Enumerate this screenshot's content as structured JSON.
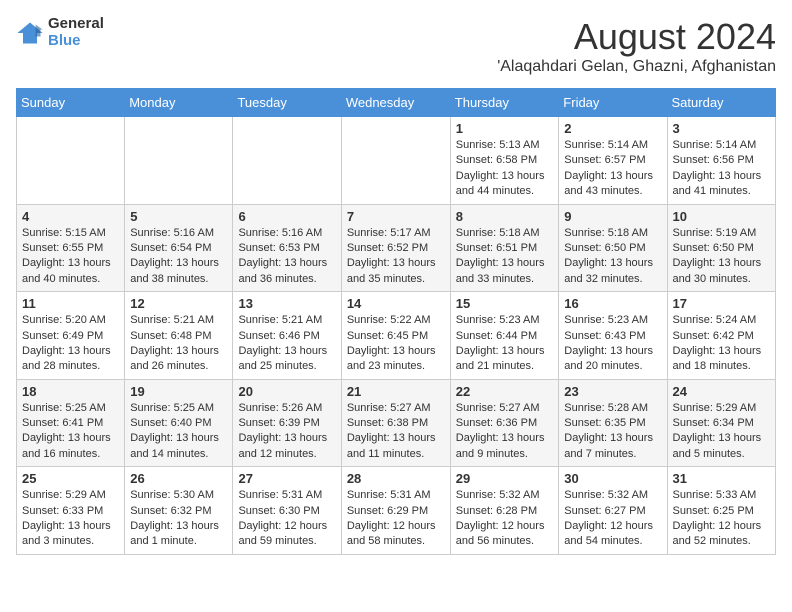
{
  "logo": {
    "general": "General",
    "blue": "Blue"
  },
  "title": {
    "month_year": "August 2024",
    "location": "'Alaqahdari Gelan, Ghazni, Afghanistan"
  },
  "weekdays": [
    "Sunday",
    "Monday",
    "Tuesday",
    "Wednesday",
    "Thursday",
    "Friday",
    "Saturday"
  ],
  "weeks": [
    [
      {
        "day": "",
        "info": ""
      },
      {
        "day": "",
        "info": ""
      },
      {
        "day": "",
        "info": ""
      },
      {
        "day": "",
        "info": ""
      },
      {
        "day": "1",
        "info": "Sunrise: 5:13 AM\nSunset: 6:58 PM\nDaylight: 13 hours\nand 44 minutes."
      },
      {
        "day": "2",
        "info": "Sunrise: 5:14 AM\nSunset: 6:57 PM\nDaylight: 13 hours\nand 43 minutes."
      },
      {
        "day": "3",
        "info": "Sunrise: 5:14 AM\nSunset: 6:56 PM\nDaylight: 13 hours\nand 41 minutes."
      }
    ],
    [
      {
        "day": "4",
        "info": "Sunrise: 5:15 AM\nSunset: 6:55 PM\nDaylight: 13 hours\nand 40 minutes."
      },
      {
        "day": "5",
        "info": "Sunrise: 5:16 AM\nSunset: 6:54 PM\nDaylight: 13 hours\nand 38 minutes."
      },
      {
        "day": "6",
        "info": "Sunrise: 5:16 AM\nSunset: 6:53 PM\nDaylight: 13 hours\nand 36 minutes."
      },
      {
        "day": "7",
        "info": "Sunrise: 5:17 AM\nSunset: 6:52 PM\nDaylight: 13 hours\nand 35 minutes."
      },
      {
        "day": "8",
        "info": "Sunrise: 5:18 AM\nSunset: 6:51 PM\nDaylight: 13 hours\nand 33 minutes."
      },
      {
        "day": "9",
        "info": "Sunrise: 5:18 AM\nSunset: 6:50 PM\nDaylight: 13 hours\nand 32 minutes."
      },
      {
        "day": "10",
        "info": "Sunrise: 5:19 AM\nSunset: 6:50 PM\nDaylight: 13 hours\nand 30 minutes."
      }
    ],
    [
      {
        "day": "11",
        "info": "Sunrise: 5:20 AM\nSunset: 6:49 PM\nDaylight: 13 hours\nand 28 minutes."
      },
      {
        "day": "12",
        "info": "Sunrise: 5:21 AM\nSunset: 6:48 PM\nDaylight: 13 hours\nand 26 minutes."
      },
      {
        "day": "13",
        "info": "Sunrise: 5:21 AM\nSunset: 6:46 PM\nDaylight: 13 hours\nand 25 minutes."
      },
      {
        "day": "14",
        "info": "Sunrise: 5:22 AM\nSunset: 6:45 PM\nDaylight: 13 hours\nand 23 minutes."
      },
      {
        "day": "15",
        "info": "Sunrise: 5:23 AM\nSunset: 6:44 PM\nDaylight: 13 hours\nand 21 minutes."
      },
      {
        "day": "16",
        "info": "Sunrise: 5:23 AM\nSunset: 6:43 PM\nDaylight: 13 hours\nand 20 minutes."
      },
      {
        "day": "17",
        "info": "Sunrise: 5:24 AM\nSunset: 6:42 PM\nDaylight: 13 hours\nand 18 minutes."
      }
    ],
    [
      {
        "day": "18",
        "info": "Sunrise: 5:25 AM\nSunset: 6:41 PM\nDaylight: 13 hours\nand 16 minutes."
      },
      {
        "day": "19",
        "info": "Sunrise: 5:25 AM\nSunset: 6:40 PM\nDaylight: 13 hours\nand 14 minutes."
      },
      {
        "day": "20",
        "info": "Sunrise: 5:26 AM\nSunset: 6:39 PM\nDaylight: 13 hours\nand 12 minutes."
      },
      {
        "day": "21",
        "info": "Sunrise: 5:27 AM\nSunset: 6:38 PM\nDaylight: 13 hours\nand 11 minutes."
      },
      {
        "day": "22",
        "info": "Sunrise: 5:27 AM\nSunset: 6:36 PM\nDaylight: 13 hours\nand 9 minutes."
      },
      {
        "day": "23",
        "info": "Sunrise: 5:28 AM\nSunset: 6:35 PM\nDaylight: 13 hours\nand 7 minutes."
      },
      {
        "day": "24",
        "info": "Sunrise: 5:29 AM\nSunset: 6:34 PM\nDaylight: 13 hours\nand 5 minutes."
      }
    ],
    [
      {
        "day": "25",
        "info": "Sunrise: 5:29 AM\nSunset: 6:33 PM\nDaylight: 13 hours\nand 3 minutes."
      },
      {
        "day": "26",
        "info": "Sunrise: 5:30 AM\nSunset: 6:32 PM\nDaylight: 13 hours\nand 1 minute."
      },
      {
        "day": "27",
        "info": "Sunrise: 5:31 AM\nSunset: 6:30 PM\nDaylight: 12 hours\nand 59 minutes."
      },
      {
        "day": "28",
        "info": "Sunrise: 5:31 AM\nSunset: 6:29 PM\nDaylight: 12 hours\nand 58 minutes."
      },
      {
        "day": "29",
        "info": "Sunrise: 5:32 AM\nSunset: 6:28 PM\nDaylight: 12 hours\nand 56 minutes."
      },
      {
        "day": "30",
        "info": "Sunrise: 5:32 AM\nSunset: 6:27 PM\nDaylight: 12 hours\nand 54 minutes."
      },
      {
        "day": "31",
        "info": "Sunrise: 5:33 AM\nSunset: 6:25 PM\nDaylight: 12 hours\nand 52 minutes."
      }
    ]
  ]
}
